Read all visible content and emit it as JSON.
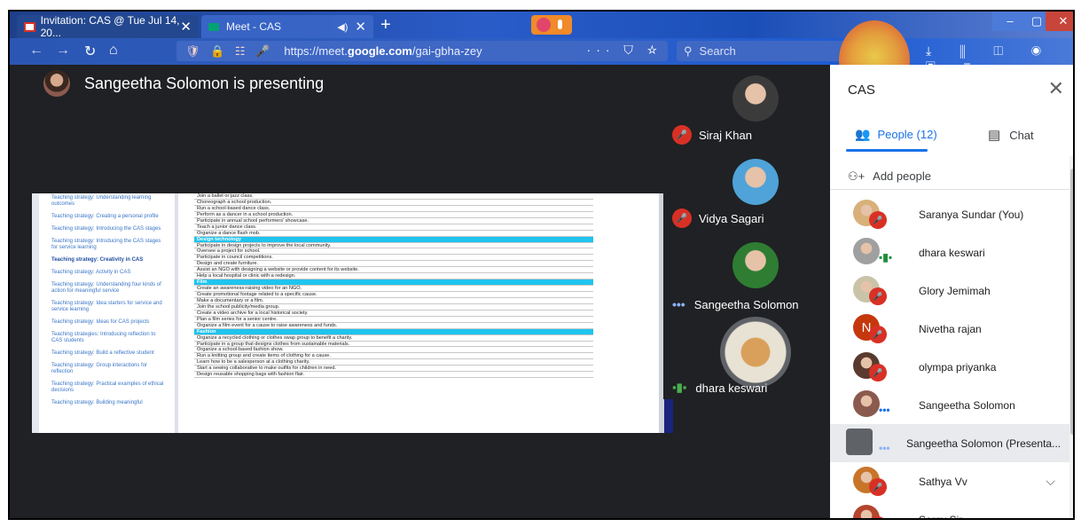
{
  "browser": {
    "tabs": [
      {
        "label": "Invitation: CAS @ Tue Jul 14, 20...",
        "close": "✕"
      },
      {
        "label": "Meet - CAS",
        "close": "✕",
        "sound": "◀)"
      }
    ],
    "new_tab": "+",
    "url_prefix": "https://meet.",
    "url_domain": "google.com",
    "url_path": "/gai-gbha-zey",
    "url_icons": "🛡 🔒 ☷ 🎤",
    "url_actions": "··· ⛉ ☆",
    "search_placeholder": "Search",
    "toolbar_icons": "⤓ ⫼ ◫ ◉ ▣ ≡",
    "window": {
      "min": "–",
      "max": "▢",
      "close": "✕"
    }
  },
  "presenting": {
    "title": "Sangeetha Solomon is presenting"
  },
  "document": {
    "sidebar_links": [
      {
        "text": "Teaching strategy: Understanding learning outcomes",
        "active": false
      },
      {
        "text": "Teaching strategy: Creating a personal profile",
        "active": false
      },
      {
        "text": "Teaching strategy: Introducing the CAS stages",
        "active": false
      },
      {
        "text": "Teaching strategy: Introducing the CAS stages for service learning",
        "active": false
      },
      {
        "text": "Teaching strategy: Creativity in CAS",
        "active": true
      },
      {
        "text": "Teaching strategy: Activity in CAS",
        "active": false
      },
      {
        "text": "Teaching strategy: Understanding four kinds of action for meaningful service",
        "active": false
      },
      {
        "text": "Teaching strategy: Idea starters for service and service learning",
        "active": false
      },
      {
        "text": "Teaching strategy: Ideas for CAS projects",
        "active": false
      },
      {
        "text": "Teaching strategies: Introducing reflection to CAS students",
        "active": false
      },
      {
        "text": "Teaching strategy: Build a reflective student",
        "active": false
      },
      {
        "text": "Teaching strategy: Group interactions for reflection",
        "active": false
      },
      {
        "text": "Teaching strategy: Practical examples of ethical decisions",
        "active": false
      },
      {
        "text": "Teaching strategy: Building meaningful",
        "active": false
      }
    ],
    "rows": [
      {
        "text": "Join a ballet or jazz class.",
        "header": false
      },
      {
        "text": "Choreograph a school production.",
        "header": false
      },
      {
        "text": "Run a school-based dance class.",
        "header": false
      },
      {
        "text": "Perform as a dancer in a school production.",
        "header": false
      },
      {
        "text": "Participate in annual school performers' showcase.",
        "header": false
      },
      {
        "text": "Teach a junior dance class.",
        "header": false
      },
      {
        "text": "Organize a dance flash mob.",
        "header": false
      },
      {
        "text": "Design technology",
        "header": true
      },
      {
        "text": "Participate in design projects to improve the local community.",
        "header": false
      },
      {
        "text": "Oversee a project for school.",
        "header": false
      },
      {
        "text": "Participate in council competitions.",
        "header": false
      },
      {
        "text": "Design and create furniture.",
        "header": false
      },
      {
        "text": "Assist an NGO with designing a website or provide content for its website.",
        "header": false
      },
      {
        "text": "Help a local hospital or clinic with a redesign.",
        "header": false
      },
      {
        "text": "Film",
        "header": true
      },
      {
        "text": "Create an awareness-raising video for an NGO.",
        "header": false
      },
      {
        "text": "Create promotional footage related to a specific cause.",
        "header": false
      },
      {
        "text": "Make a documentary or a film.",
        "header": false
      },
      {
        "text": "Join the school publicity/media group.",
        "header": false
      },
      {
        "text": "Create a video archive for a local historical society.",
        "header": false
      },
      {
        "text": "Plan a film series for a senior centre.",
        "header": false
      },
      {
        "text": "Organize a film event for a cause to raise awareness and funds.",
        "header": false
      },
      {
        "text": "Fashion",
        "header": true
      },
      {
        "text": "Organize a recycled clothing or clothes swap group to benefit a charity.",
        "header": false
      },
      {
        "text": "Participate in a group that designs clothes from sustainable materials.",
        "header": false
      },
      {
        "text": "Organize a school-based fashion show.",
        "header": false
      },
      {
        "text": "Run a knitting group and create items of clothing for a cause.",
        "header": false
      },
      {
        "text": "Learn how to be a salesperson at a clothing charity.",
        "header": false
      },
      {
        "text": "Start a sewing collaborative to make outfits for children in need.",
        "header": false
      },
      {
        "text": "Design reusable shopping bags with fashion flair.",
        "header": false
      }
    ]
  },
  "tiles": [
    {
      "name": "Siraj Khan",
      "status": "muted",
      "avatar_color": "#3b3b3b"
    },
    {
      "name": "Vidya Sagari",
      "status": "muted",
      "avatar_color": "#4fa3d8"
    },
    {
      "name": "Sangeetha Solomon",
      "status": "dots",
      "avatar_color": "#2e7d32"
    },
    {
      "name": "dhara keswari",
      "status": "speaking",
      "avatar_color": "#b3b3b3"
    }
  ],
  "panel": {
    "title": "CAS",
    "close": "✕",
    "people_tab": "People (12)",
    "chat_tab": "Chat",
    "add_people": "Add people",
    "people": [
      {
        "name": "Saranya Sundar (You)",
        "status": "muted",
        "color": "#d8b07a"
      },
      {
        "name": "dhara keswari",
        "status": "speaking",
        "color": "#a0a0a0"
      },
      {
        "name": "Glory Jemimah",
        "status": "muted",
        "color": "#c9c4a8"
      },
      {
        "name": "Nivetha rajan",
        "status": "muted",
        "color": "#c5380c",
        "initial": "N"
      },
      {
        "name": "olympa priyanka",
        "status": "muted",
        "color": "#5a3a2e"
      },
      {
        "name": "Sangeetha Solomon",
        "status": "dots",
        "color": "#8b5a4e"
      },
      {
        "name": "Sangeetha Solomon (Presenta...",
        "status": "presenting",
        "color": "#5f6368"
      },
      {
        "name": "Sathya Vv",
        "status": "muted",
        "color": "#c8752a"
      },
      {
        "name": "Sergy Sir",
        "status": "muted",
        "color": "#b4452e"
      }
    ]
  }
}
